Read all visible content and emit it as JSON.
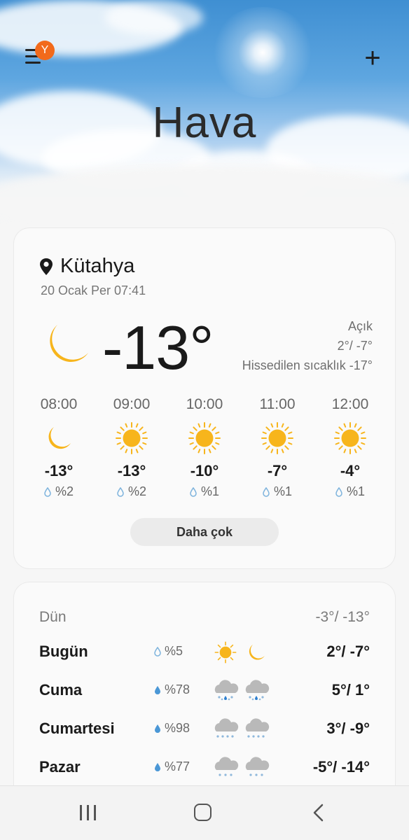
{
  "header": {
    "menu_badge": "Y",
    "title": "Hava",
    "add_label": "+"
  },
  "current": {
    "city": "Kütahya",
    "datetime": "20 Ocak Per 07:41",
    "temperature": "-13°",
    "condition": "Açık",
    "high_low": "2°/ -7°",
    "feels_like": "Hissedilen sıcaklık -17°",
    "icon": "moon-icon"
  },
  "hourly": [
    {
      "time": "08:00",
      "icon": "moon-icon",
      "temp": "-13°",
      "rain": "%2"
    },
    {
      "time": "09:00",
      "icon": "sun-icon",
      "temp": "-13°",
      "rain": "%2"
    },
    {
      "time": "10:00",
      "icon": "sun-icon",
      "temp": "-10°",
      "rain": "%1"
    },
    {
      "time": "11:00",
      "icon": "sun-icon",
      "temp": "-7°",
      "rain": "%1"
    },
    {
      "time": "12:00",
      "icon": "sun-icon",
      "temp": "-4°",
      "rain": "%1"
    }
  ],
  "more_button": "Daha çok",
  "daily": {
    "yesterday": {
      "label": "Dün",
      "temps": "-3°/ -13°"
    },
    "days": [
      {
        "name": "Bugün",
        "rain": "%5",
        "day_icon": "sun-icon",
        "night_icon": "moon-icon",
        "temps": "2°/ -7°"
      },
      {
        "name": "Cuma",
        "rain": "%78",
        "day_icon": "cloud-sleet-icon",
        "night_icon": "cloud-sleet-icon",
        "temps": "5°/ 1°"
      },
      {
        "name": "Cumartesi",
        "rain": "%98",
        "day_icon": "cloud-snow-icon",
        "night_icon": "cloud-snow-icon",
        "temps": "3°/ -9°"
      },
      {
        "name": "Pazar",
        "rain": "%77",
        "day_icon": "cloud-snow-icon",
        "night_icon": "cloud-snow-icon",
        "temps": "-5°/ -14°"
      }
    ]
  },
  "colors": {
    "accent_sun": "#f7b51c",
    "badge": "#f26a1b",
    "drop_light": "#7fb4dd",
    "drop_filled": "#4a97d6"
  }
}
